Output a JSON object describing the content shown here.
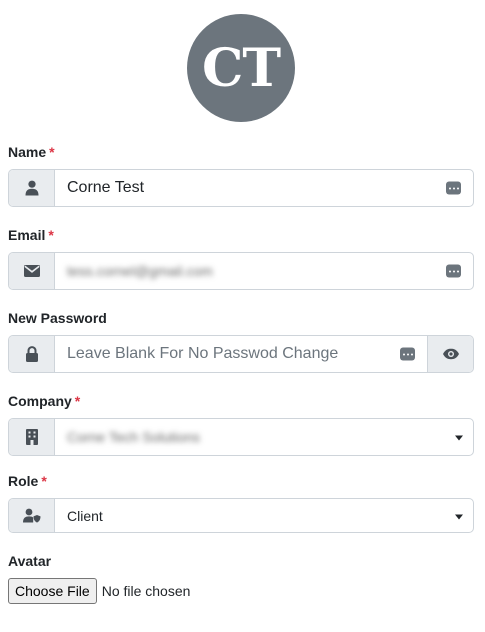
{
  "avatar": {
    "initials": "CT"
  },
  "fields": {
    "name": {
      "label": "Name",
      "required_mark": "*",
      "value": "Corne Test"
    },
    "email": {
      "label": "Email",
      "required_mark": "*",
      "value": "tess.cornel@gmail.com"
    },
    "password": {
      "label": "New Password",
      "placeholder": "Leave Blank For No Passwod Change"
    },
    "company": {
      "label": "Company",
      "required_mark": "*",
      "selected": "Corne Tech Solutions"
    },
    "role": {
      "label": "Role",
      "required_mark": "*",
      "selected": "Client"
    },
    "avatar_upload": {
      "label": "Avatar",
      "button_label": "Choose File",
      "status": "No file chosen"
    }
  },
  "icons": {
    "name": "user-icon",
    "email": "envelope-icon",
    "password": "lock-icon",
    "password_toggle": "eye-icon",
    "company": "building-icon",
    "role": "user-shield-icon",
    "autofill": "password-manager-icon"
  },
  "colors": {
    "avatar_bg": "#6c757d",
    "required": "#dc3545",
    "addon_bg": "#e9ecef",
    "border": "#ced4da"
  }
}
